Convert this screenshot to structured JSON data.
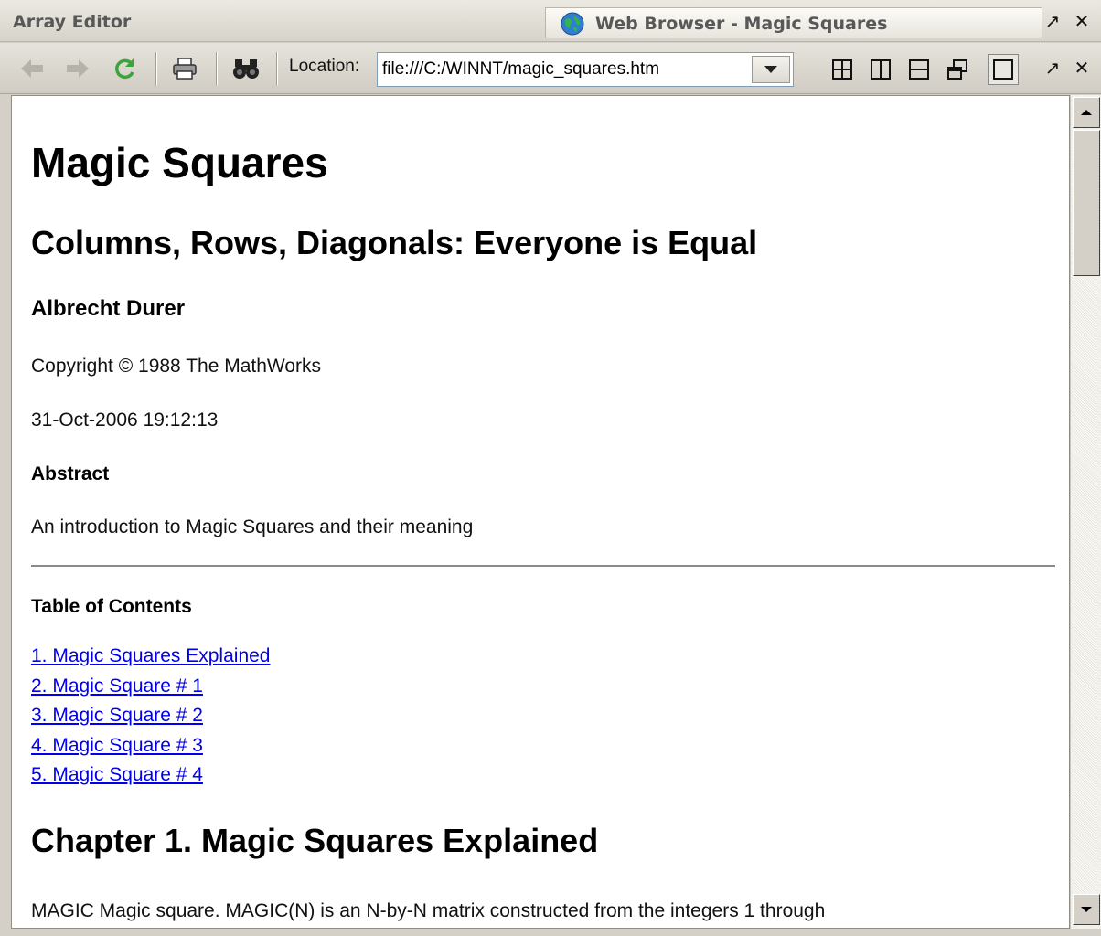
{
  "titlebar": {
    "left_tab": "Array Editor",
    "active_tab": "Web Browser - Magic Squares",
    "undock_glyph": "↗",
    "close_glyph": "✕"
  },
  "toolbar": {
    "location_label": "Location:",
    "location_value": "file:///C:/WINNT/magic_squares.htm",
    "icons": [
      "back-arrow-icon",
      "forward-arrow-icon",
      "refresh-icon",
      "print-icon",
      "find-binoculars-icon",
      "grid-tile-icon",
      "split-columns-icon",
      "split-rows-icon",
      "cascade-windows-icon",
      "maximize-document-icon"
    ]
  },
  "page": {
    "title": "Magic Squares",
    "subtitle": "Columns, Rows, Diagonals: Everyone is Equal",
    "author": "Albrecht Durer",
    "copyright": "Copyright © 1988 The MathWorks",
    "date": "31-Oct-2006 19:12:13",
    "abstract_heading": "Abstract",
    "abstract_text": "An introduction to Magic Squares and their meaning",
    "toc_heading": "Table of Contents",
    "toc": [
      "1. Magic Squares Explained",
      "2. Magic Square # 1",
      "3. Magic Square # 2",
      "4. Magic Square # 3",
      "5. Magic Square # 4"
    ],
    "chapter_heading": "Chapter 1. Magic Squares Explained",
    "chapter_text": "MAGIC Magic square. MAGIC(N) is an N-by-N matrix constructed from the integers 1 through"
  },
  "colors": {
    "link": "#0000ee",
    "refresh_green": "#3aa53a"
  }
}
